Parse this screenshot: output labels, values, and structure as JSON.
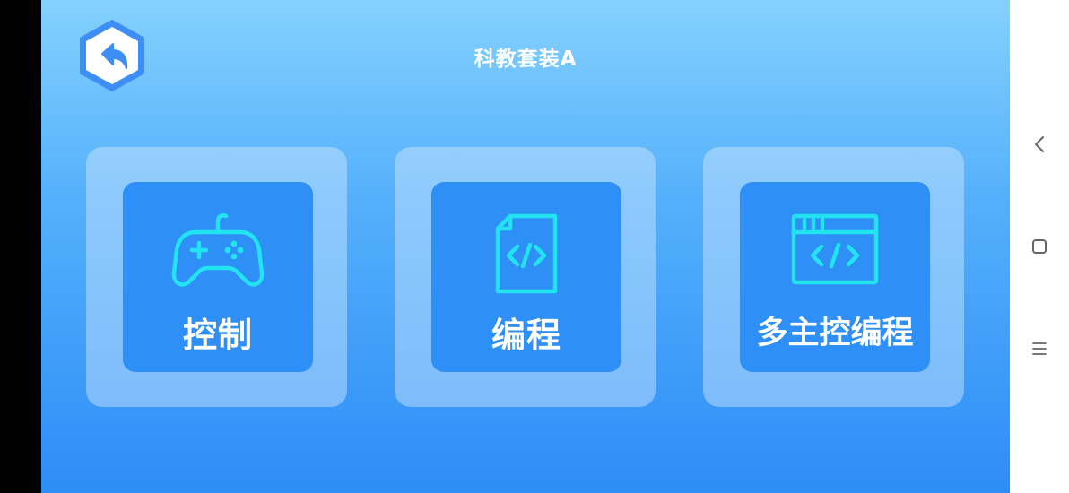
{
  "header": {
    "title": "科教套装A",
    "back_icon": "back-arrow-icon"
  },
  "cards": [
    {
      "label": "控制",
      "icon": "gamepad-icon"
    },
    {
      "label": "编程",
      "icon": "code-file-icon"
    },
    {
      "label": "多主控编程",
      "icon": "code-window-icon"
    }
  ],
  "system_nav": {
    "back_icon": "nav-back-icon",
    "home_icon": "nav-home-icon",
    "menu_icon": "nav-menu-icon"
  },
  "colors": {
    "accent": "#2e8ff7",
    "icon_cyan": "#22e3f0",
    "back_button": "#3d8ef5"
  }
}
